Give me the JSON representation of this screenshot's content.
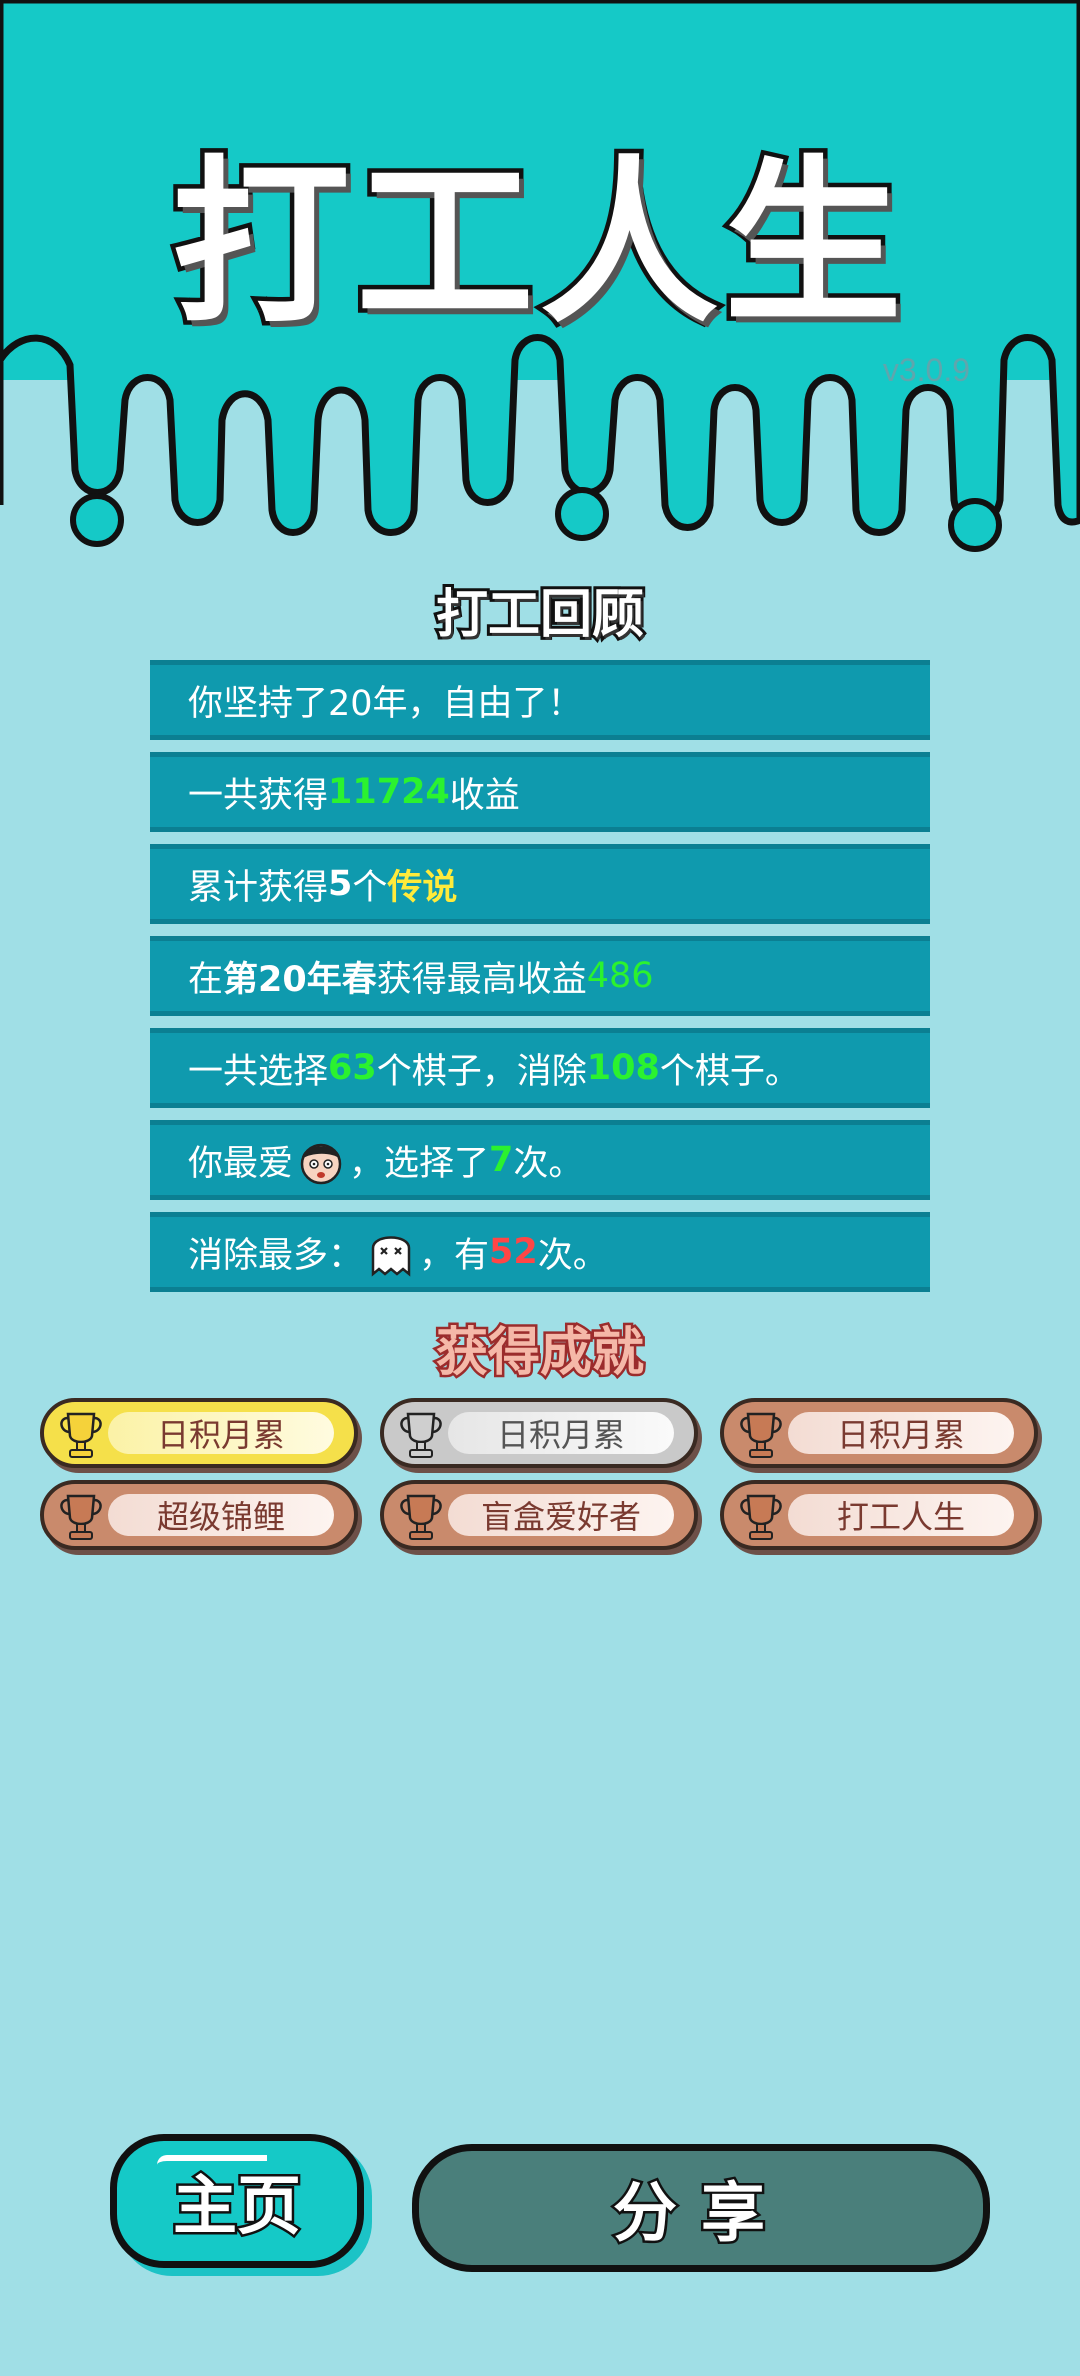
{
  "app": {
    "title": "打工人生",
    "version": "v3.0.9"
  },
  "review": {
    "title": "打工回顾",
    "rows": [
      {
        "parts": [
          "你坚持了20年，自由了！"
        ]
      },
      {
        "pre": "一共获得",
        "value": "11724",
        "post": "收益"
      },
      {
        "pre": "累计获得",
        "count": "5",
        "mid": "个",
        "highlight": "传说"
      },
      {
        "pre": "在 ",
        "season": "第20年春",
        "mid": " 获得最高收益",
        "value": "486"
      },
      {
        "pre": "一共选择",
        "chosen": "63",
        "mid": "个棋子，消除",
        "removed": "108",
        "post": "个棋子。"
      },
      {
        "pre": "你最爱",
        "icon": "boy-face-icon",
        "mid": "，选择了",
        "times": "7",
        "post": "次。"
      },
      {
        "pre": "消除最多：",
        "icon": "ghost-icon",
        "mid": "，有",
        "times": "52",
        "post": "次。"
      }
    ]
  },
  "achievements": {
    "title": "获得成就",
    "items": [
      {
        "label": "日积月累",
        "tier": "gold"
      },
      {
        "label": "日积月累",
        "tier": "silver"
      },
      {
        "label": "日积月累",
        "tier": "bronze"
      },
      {
        "label": "超级锦鲤",
        "tier": "bronze"
      },
      {
        "label": "盲盒爱好者",
        "tier": "bronze"
      },
      {
        "label": "打工人生",
        "tier": "bronze"
      }
    ]
  },
  "buttons": {
    "home": "主页",
    "share": "分享"
  },
  "colors": {
    "header": "#15c9c7",
    "background": "#a0dfe6",
    "row": "#0f9aae",
    "green": "#2bf22f",
    "yellow": "#ffeb3b",
    "red": "#ff4646"
  }
}
